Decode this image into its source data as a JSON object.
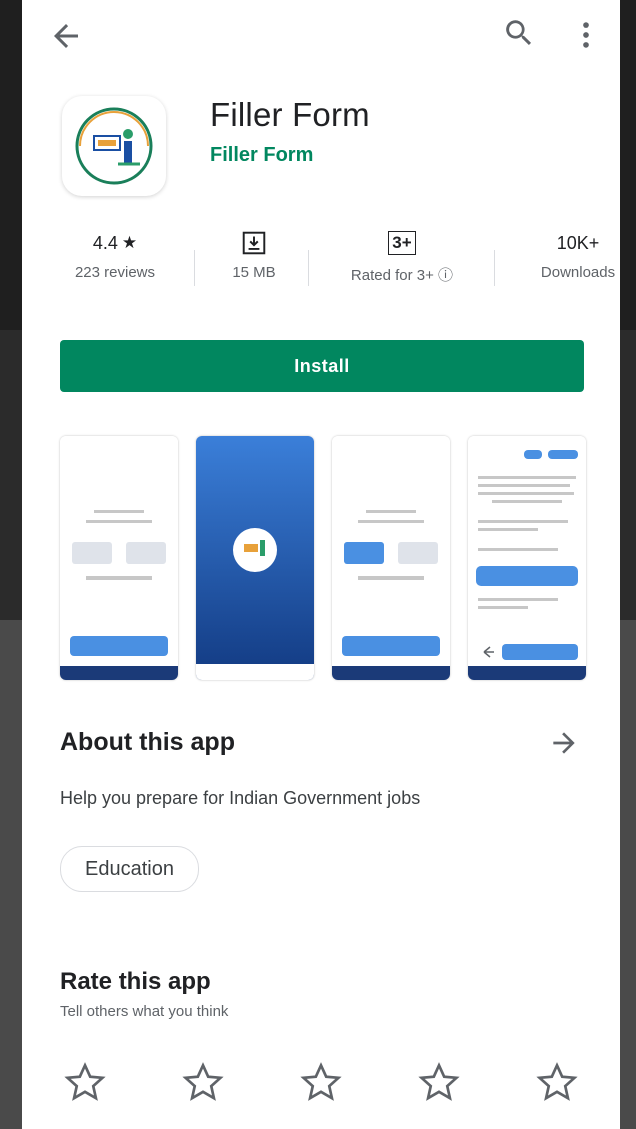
{
  "app": {
    "title": "Filler Form",
    "developer": "Filler Form",
    "install_label": "Install"
  },
  "stats": {
    "rating": "4.4",
    "rating_star": "★",
    "reviews": "223 reviews",
    "size_label": "15 MB",
    "content_rating_badge": "3+",
    "content_rating_label": "Rated for 3+ ⓘ",
    "downloads": "10K+",
    "downloads_label": "Downloads"
  },
  "about": {
    "title": "About this app",
    "description": "Help you prepare for Indian Government jobs",
    "category_chip": "Education"
  },
  "rate": {
    "title": "Rate this app",
    "subtitle": "Tell others what you think",
    "stars_filled": 0,
    "stars_total": 5
  },
  "colors": {
    "accent": "#01875f",
    "screenshot_blue": "#1a4fa3",
    "button_blue": "#4a90e2"
  },
  "icons": [
    "back-arrow-icon",
    "search-icon",
    "more-vert-icon",
    "download-icon",
    "arrow-right-icon",
    "star-outline-icon"
  ]
}
